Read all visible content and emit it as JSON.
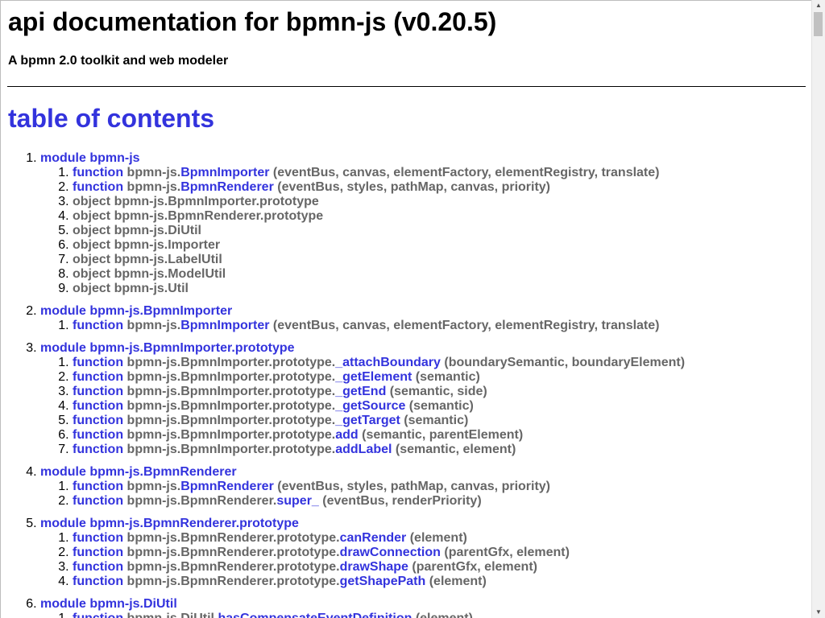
{
  "header": {
    "title": "api documentation for bpmn-js (v0.20.5)",
    "subtitle": "A bpmn 2.0 toolkit and web modeler"
  },
  "toc": {
    "title": "table of contents",
    "modules": [
      {
        "label": "module bpmn-js",
        "items": [
          {
            "kind": "function",
            "prefix": "bpmn-js.",
            "name": "BpmnImporter",
            "args": " (eventBus, canvas, elementFactory, elementRegistry, translate)"
          },
          {
            "kind": "function",
            "prefix": "bpmn-js.",
            "name": "BpmnRenderer",
            "args": " (eventBus, styles, pathMap, canvas, priority)"
          },
          {
            "kind": "object",
            "text": "object bpmn-js.BpmnImporter.prototype"
          },
          {
            "kind": "object",
            "text": "object bpmn-js.BpmnRenderer.prototype"
          },
          {
            "kind": "object",
            "text": "object bpmn-js.DiUtil"
          },
          {
            "kind": "object",
            "text": "object bpmn-js.Importer"
          },
          {
            "kind": "object",
            "text": "object bpmn-js.LabelUtil"
          },
          {
            "kind": "object",
            "text": "object bpmn-js.ModelUtil"
          },
          {
            "kind": "object",
            "text": "object bpmn-js.Util"
          }
        ]
      },
      {
        "label": "module bpmn-js.BpmnImporter",
        "items": [
          {
            "kind": "function",
            "prefix": "bpmn-js.",
            "name": "BpmnImporter",
            "args": " (eventBus, canvas, elementFactory, elementRegistry, translate)"
          }
        ]
      },
      {
        "label": "module bpmn-js.BpmnImporter.prototype",
        "items": [
          {
            "kind": "function",
            "prefix": "bpmn-js.BpmnImporter.prototype.",
            "name": "_attachBoundary",
            "args": " (boundarySemantic, boundaryElement)"
          },
          {
            "kind": "function",
            "prefix": "bpmn-js.BpmnImporter.prototype.",
            "name": "_getElement",
            "args": " (semantic)"
          },
          {
            "kind": "function",
            "prefix": "bpmn-js.BpmnImporter.prototype.",
            "name": "_getEnd",
            "args": " (semantic, side)"
          },
          {
            "kind": "function",
            "prefix": "bpmn-js.BpmnImporter.prototype.",
            "name": "_getSource",
            "args": " (semantic)"
          },
          {
            "kind": "function",
            "prefix": "bpmn-js.BpmnImporter.prototype.",
            "name": "_getTarget",
            "args": " (semantic)"
          },
          {
            "kind": "function",
            "prefix": "bpmn-js.BpmnImporter.prototype.",
            "name": "add",
            "args": " (semantic, parentElement)"
          },
          {
            "kind": "function",
            "prefix": "bpmn-js.BpmnImporter.prototype.",
            "name": "addLabel",
            "args": " (semantic, element)"
          }
        ]
      },
      {
        "label": "module bpmn-js.BpmnRenderer",
        "items": [
          {
            "kind": "function",
            "prefix": "bpmn-js.",
            "name": "BpmnRenderer",
            "args": " (eventBus, styles, pathMap, canvas, priority)"
          },
          {
            "kind": "function",
            "prefix": "bpmn-js.BpmnRenderer.",
            "name": "super_",
            "args": " (eventBus, renderPriority)"
          }
        ]
      },
      {
        "label": "module bpmn-js.BpmnRenderer.prototype",
        "items": [
          {
            "kind": "function",
            "prefix": "bpmn-js.BpmnRenderer.prototype.",
            "name": "canRender",
            "args": " (element)"
          },
          {
            "kind": "function",
            "prefix": "bpmn-js.BpmnRenderer.prototype.",
            "name": "drawConnection",
            "args": " (parentGfx, element)"
          },
          {
            "kind": "function",
            "prefix": "bpmn-js.BpmnRenderer.prototype.",
            "name": "drawShape",
            "args": " (parentGfx, element)"
          },
          {
            "kind": "function",
            "prefix": "bpmn-js.BpmnRenderer.prototype.",
            "name": "getShapePath",
            "args": " (element)"
          }
        ]
      },
      {
        "label": "module bpmn-js.DiUtil",
        "items": [
          {
            "kind": "function",
            "prefix": "bpmn-js.DiUtil.",
            "name": "hasCompensateEventDefinition",
            "args": " (element)"
          }
        ]
      }
    ]
  },
  "scrollbar": {
    "up_icon": "▲",
    "down_icon": "▼"
  }
}
